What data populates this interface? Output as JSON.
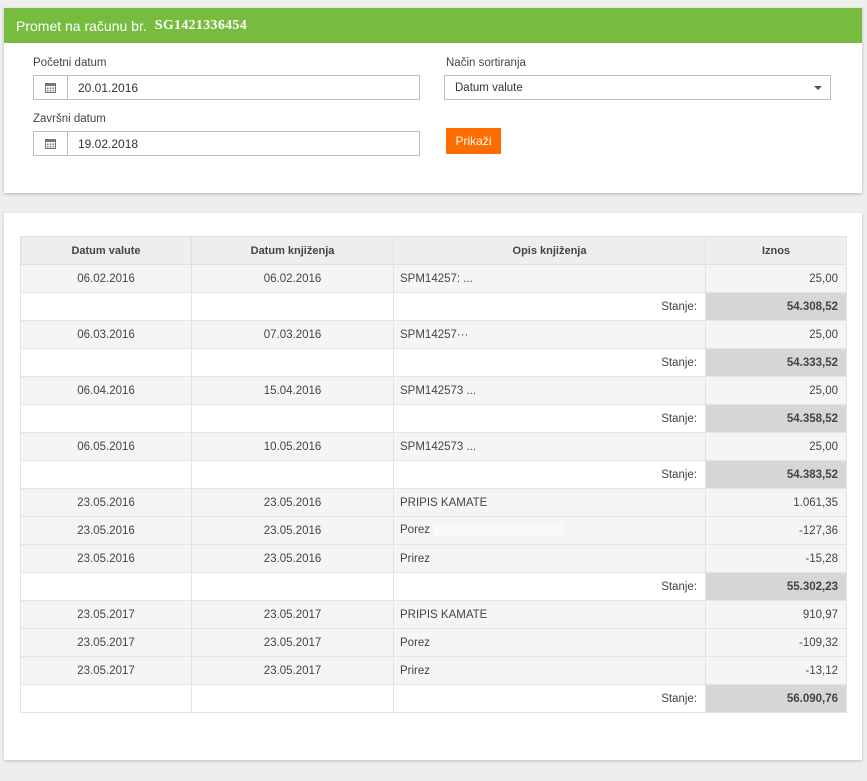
{
  "header": {
    "title": "Promet na računu br.",
    "account": "SG1421336454"
  },
  "form": {
    "start_date_label": "Početni datum",
    "start_date_value": "20.01.2016",
    "end_date_label": "Završni datum",
    "end_date_value": "19.02.2018",
    "sort_label": "Način sortiranja",
    "sort_value": "Datum valute",
    "submit_label": "Prikaži"
  },
  "table": {
    "headers": [
      "Datum valute",
      "Datum knjiženja",
      "Opis knjiženja",
      "Iznos"
    ],
    "stanje_label": "Stanje:",
    "rows": [
      {
        "type": "tx",
        "value_date": "06.02.2016",
        "booking_date": "06.02.2016",
        "desc": "SPM14257: ...",
        "amount": "25,00"
      },
      {
        "type": "balance",
        "amount": "54.308,52"
      },
      {
        "type": "tx",
        "value_date": "06.03.2016",
        "booking_date": "07.03.2016",
        "desc": "SPM14257···",
        "amount": "25,00"
      },
      {
        "type": "balance",
        "amount": "54.333,52"
      },
      {
        "type": "tx",
        "value_date": "06.04.2016",
        "booking_date": "15.04.2016",
        "desc": "SPM142573 ...",
        "amount": "25,00"
      },
      {
        "type": "balance",
        "amount": "54.358,52"
      },
      {
        "type": "tx",
        "value_date": "06.05.2016",
        "booking_date": "10.05.2016",
        "desc": "SPM142573 ...",
        "amount": "25,00"
      },
      {
        "type": "balance",
        "amount": "54.383,52"
      },
      {
        "type": "tx",
        "value_date": "23.05.2016",
        "booking_date": "23.05.2016",
        "desc": "PRIPIS KAMATE",
        "amount": "1.061,35"
      },
      {
        "type": "tx",
        "value_date": "23.05.2016",
        "booking_date": "23.05.2016",
        "desc": "Porez",
        "amount": "-127,36"
      },
      {
        "type": "tx",
        "value_date": "23.05.2016",
        "booking_date": "23.05.2016",
        "desc": "Prirez",
        "amount": "-15,28"
      },
      {
        "type": "balance",
        "amount": "55.302,23"
      },
      {
        "type": "tx",
        "value_date": "23.05.2017",
        "booking_date": "23.05.2017",
        "desc": "PRIPIS KAMATE",
        "amount": "910,97"
      },
      {
        "type": "tx",
        "value_date": "23.05.2017",
        "booking_date": "23.05.2017",
        "desc": "Porez",
        "amount": "-109,32"
      },
      {
        "type": "tx",
        "value_date": "23.05.2017",
        "booking_date": "23.05.2017",
        "desc": "Prirez",
        "amount": "-13,12"
      },
      {
        "type": "balance",
        "amount": "56.090,76"
      }
    ]
  },
  "colors": {
    "header_green": "#77bc3f",
    "button_orange": "#ff6d00",
    "balance_bg": "#d6d6d6"
  }
}
